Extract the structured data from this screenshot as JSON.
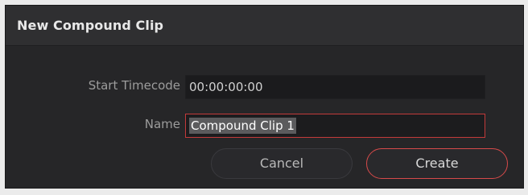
{
  "dialog": {
    "title": "New Compound Clip",
    "start_timecode_label": "Start Timecode",
    "start_timecode_value": "00:00:00:00",
    "name_label": "Name",
    "name_value": "Compound Clip 1",
    "cancel_label": "Cancel",
    "create_label": "Create",
    "accent_color": "#d64a4a"
  }
}
